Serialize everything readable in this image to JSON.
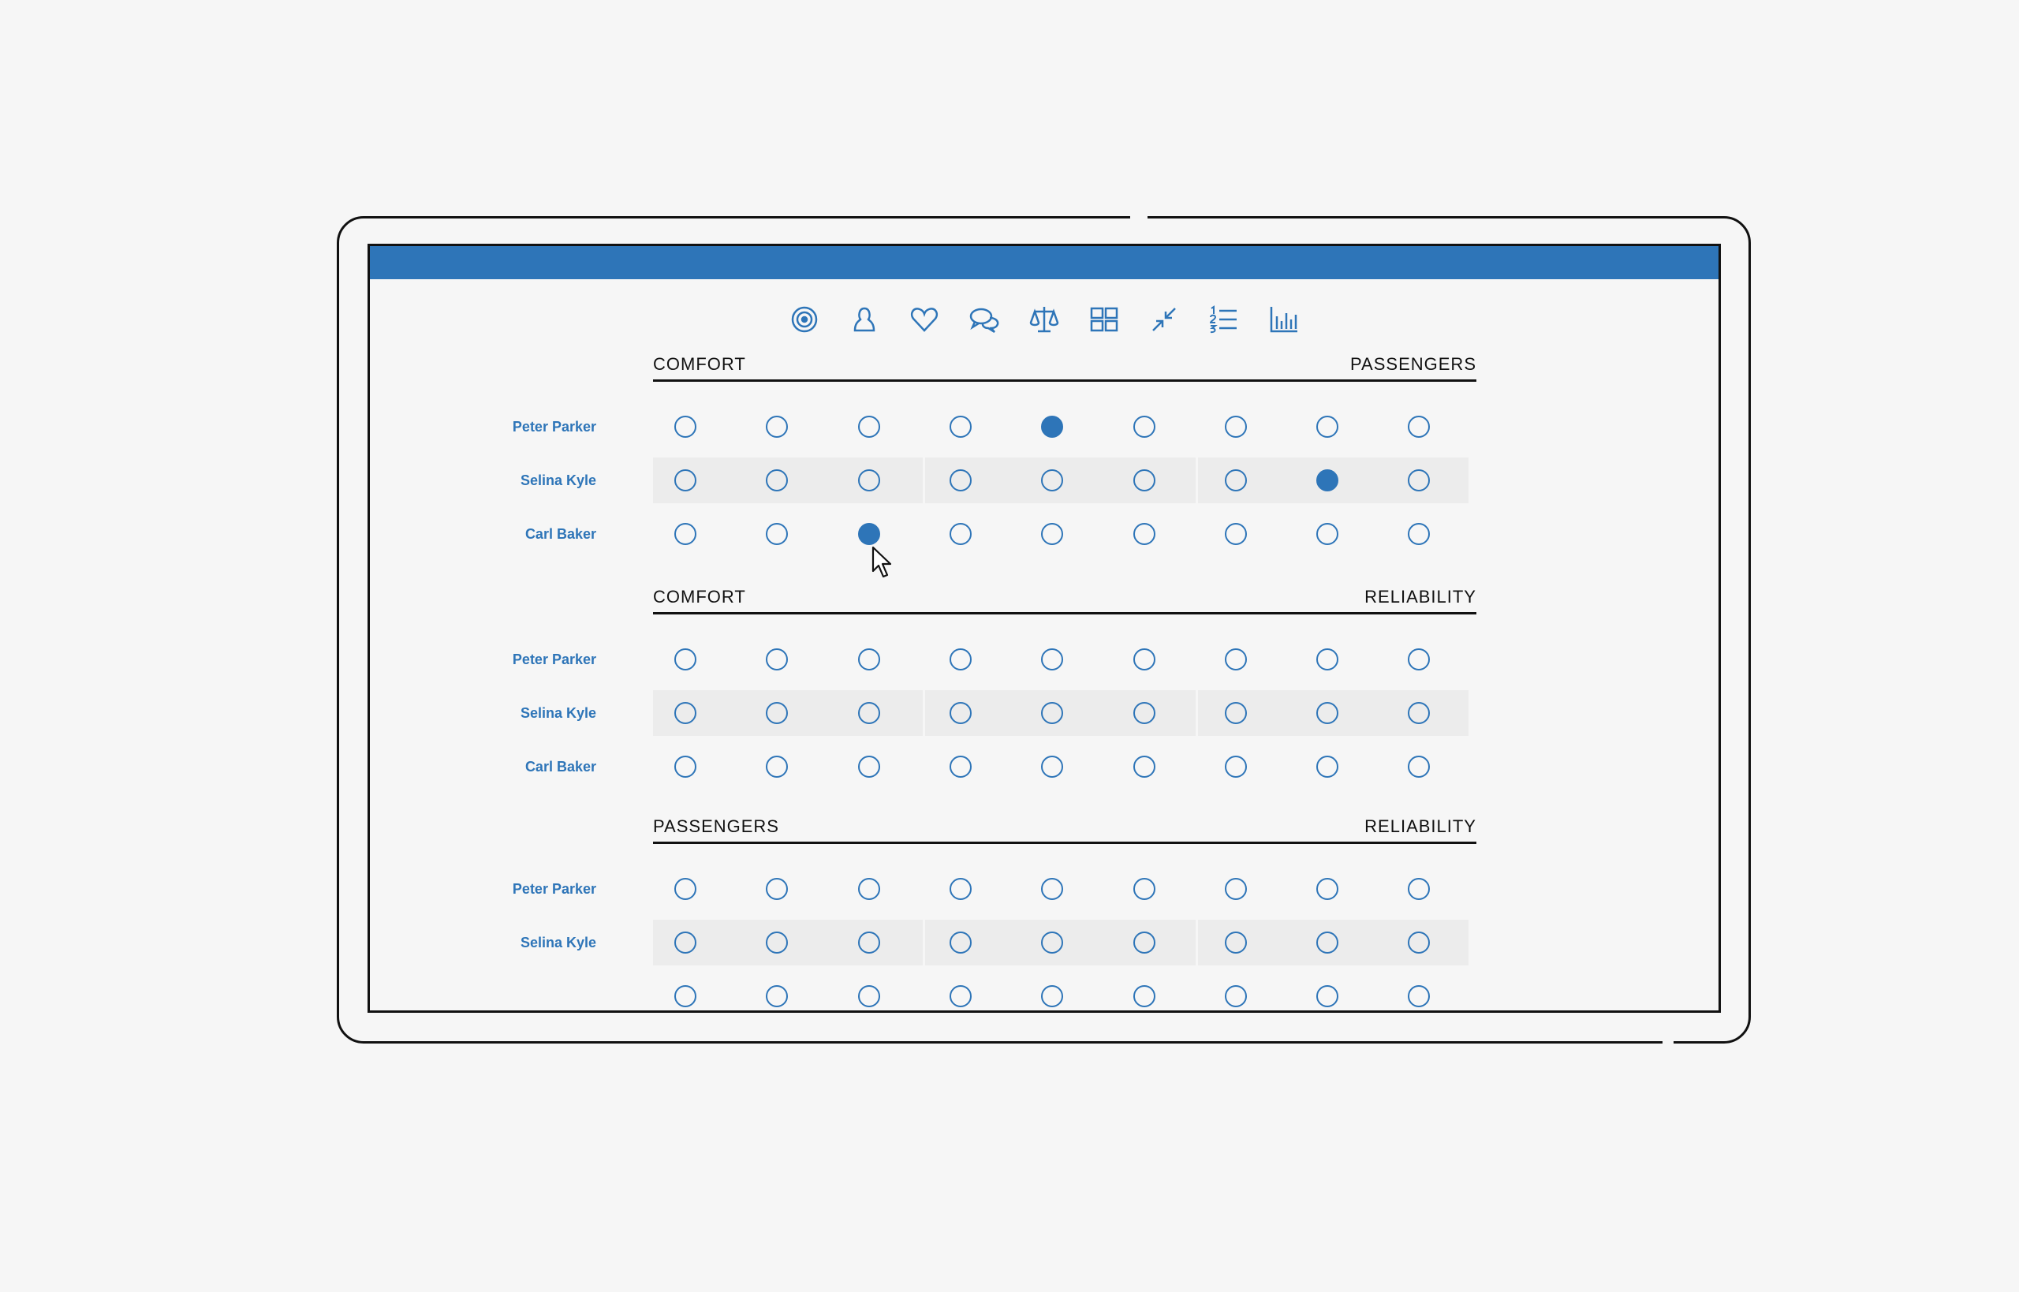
{
  "colors": {
    "accent": "#2e75b8",
    "band": "#ececec",
    "ink": "#111111",
    "background": "#f6f6f6"
  },
  "toolbar": {
    "icons": [
      "target-icon",
      "person-icon",
      "heart-icon",
      "chat-bubbles-icon",
      "balance-scale-icon",
      "grid-icon",
      "compress-icon",
      "numbered-list-icon",
      "bar-chart-icon"
    ]
  },
  "sections": [
    {
      "left_label": "COMFORT",
      "right_label": "PASSENGERS",
      "rows": [
        {
          "name": "Peter Parker",
          "selected": 5
        },
        {
          "name": "Selina Kyle",
          "selected": 8
        },
        {
          "name": "Carl Baker",
          "selected": 3
        }
      ]
    },
    {
      "left_label": "COMFORT",
      "right_label": "RELIABILITY",
      "rows": [
        {
          "name": "Peter Parker",
          "selected": null
        },
        {
          "name": "Selina Kyle",
          "selected": null
        },
        {
          "name": "Carl Baker",
          "selected": null
        }
      ]
    },
    {
      "left_label": "PASSENGERS",
      "right_label": "RELIABILITY",
      "rows": [
        {
          "name": "Peter Parker",
          "selected": null
        },
        {
          "name": "Selina Kyle",
          "selected": null
        },
        {
          "name": "",
          "selected": null
        }
      ]
    }
  ],
  "scale_points": 9
}
